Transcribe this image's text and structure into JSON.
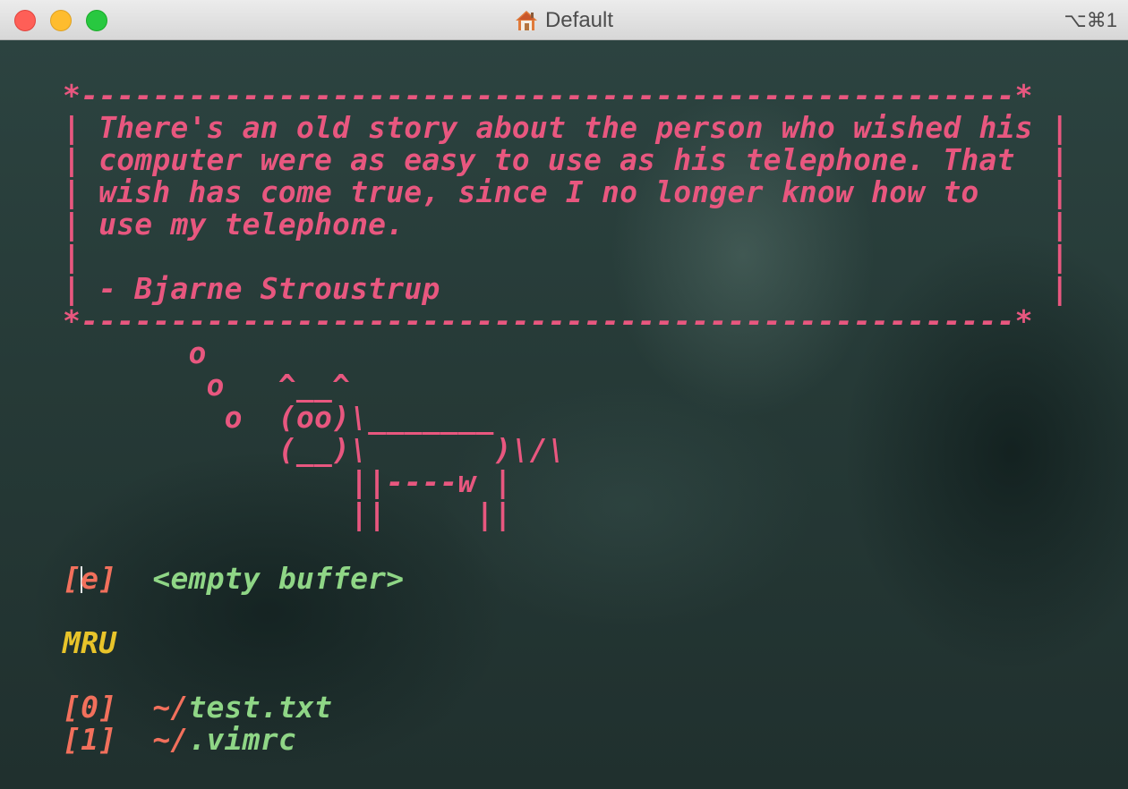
{
  "window": {
    "title": "Default",
    "title_icon": "home-icon",
    "shortcut": "⌥⌘1",
    "traffic_lights": [
      "close",
      "minimize",
      "zoom"
    ]
  },
  "startify": {
    "quote_box": {
      "top_border": "*----------------------------------------------------*",
      "lines": [
        "| There's an old story about the person who wished his |",
        "| computer were as easy to use as his telephone. That  |",
        "| wish has come true, since I no longer know how to    |",
        "| use my telephone.                                    |",
        "|                                                      |",
        "| - Bjarne Stroustrup                                  |"
      ],
      "bottom_border": "*----------------------------------------------------*"
    },
    "cow": [
      "       o",
      "        o   ^__^",
      "         o  (oo)\\_______",
      "            (__)\\       )\\/\\",
      "                ||----w |",
      "                ||     ||"
    ],
    "empty_buffer": {
      "key_open": "[",
      "key": "e",
      "key_close": "]",
      "label": "<empty buffer>"
    },
    "mru_header": "MRU",
    "mru": [
      {
        "key": "[0]",
        "prefix": "~/",
        "file": "test.txt"
      },
      {
        "key": "[1]",
        "prefix": "~/",
        "file": ".vimrc"
      }
    ]
  },
  "colors": {
    "quote": "#e8577f",
    "path": "#8fd686",
    "index": "#f2705c",
    "header": "#e8c42a",
    "background": "#263a37"
  }
}
